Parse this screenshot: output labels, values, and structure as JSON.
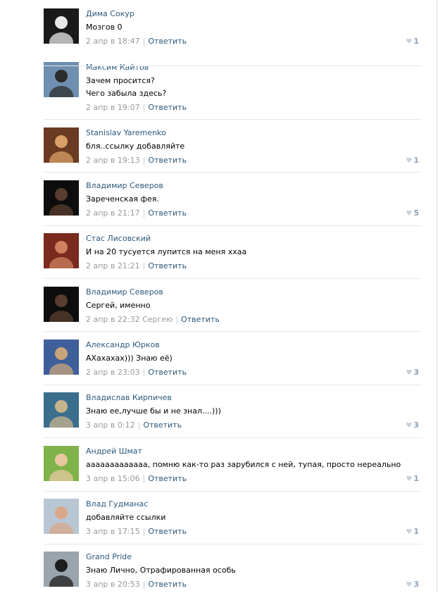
{
  "colors": {
    "link": "#2b587a",
    "meta": "#999999",
    "divider": "#e4e8ed",
    "like": "#8fa1b3"
  },
  "reply_label": "Ответить",
  "comments": [
    {
      "author": "Дима Сокур",
      "lines": [
        "Мозгов 0"
      ],
      "date": "2 апр в 18:47",
      "likes": "1",
      "avatar_colors": [
        "#1a1a1a",
        "#e8e8e8"
      ]
    },
    {
      "author": "Максим Кайтов",
      "lines": [
        "Зачем просится?",
        "Чего забыла здесь?"
      ],
      "date": "2 апр в 19:07",
      "likes": "",
      "avatar_colors": [
        "#6f8fb0",
        "#2c2c2c"
      ]
    },
    {
      "author": "Stanislav Yaremenko",
      "lines": [
        "бля..ссылку добавляйте"
      ],
      "date": "2 апр в 19:13",
      "likes": "1",
      "avatar_colors": [
        "#6b3a22",
        "#d9a066"
      ]
    },
    {
      "author": "Владимир Северов",
      "lines": [
        "Зареченская фея."
      ],
      "date": "2 апр в 21:17",
      "likes": "5",
      "avatar_colors": [
        "#0d0d0d",
        "#5a3d2e"
      ]
    },
    {
      "author": "Стас Лисовский",
      "lines": [
        "И на 20 тусуется лупится на меня ххаа"
      ],
      "date": "2 апр в 21:21",
      "likes": "",
      "avatar_colors": [
        "#7a2a1e",
        "#d08060"
      ]
    },
    {
      "author": "Владимир Северов",
      "lines": [
        "Сергей, именно"
      ],
      "date": "2 апр в 22:32 Сергею",
      "likes": "",
      "avatar_colors": [
        "#0d0d0d",
        "#5a3d2e"
      ]
    },
    {
      "author": "Александр Юрков",
      "lines": [
        "АХахахах))) Знаю её)"
      ],
      "date": "2 апр в 23:03",
      "likes": "3",
      "avatar_colors": [
        "#3f5f9a",
        "#c9a37a"
      ]
    },
    {
      "author": "Владислав Кирпичев",
      "lines": [
        "Знаю ее,лучше бы и не знал....)))"
      ],
      "date": "3 апр в 0:12",
      "likes": "3",
      "avatar_colors": [
        "#3a6e8c",
        "#c8b48c"
      ]
    },
    {
      "author": "Андрей Шмат",
      "lines": [
        "ааааааааааааа, помню как-то раз зарубился с ней, тупая, просто нереально"
      ],
      "date": "3 апр в 15:06",
      "likes": "1",
      "avatar_colors": [
        "#7fb34a",
        "#e8c8a0"
      ]
    },
    {
      "author": "Влад Гудманас",
      "lines": [
        "добавляйте ссылки"
      ],
      "date": "3 апр в 17:15",
      "likes": "1",
      "avatar_colors": [
        "#b8c6d4",
        "#d8a88a"
      ]
    },
    {
      "author": "Grand Pride",
      "lines": [
        "Знаю Лично, Отрафированная особь"
      ],
      "date": "3 апр в 20:53",
      "likes": "3",
      "avatar_colors": [
        "#9aa4ac",
        "#1e1e1e"
      ]
    }
  ]
}
